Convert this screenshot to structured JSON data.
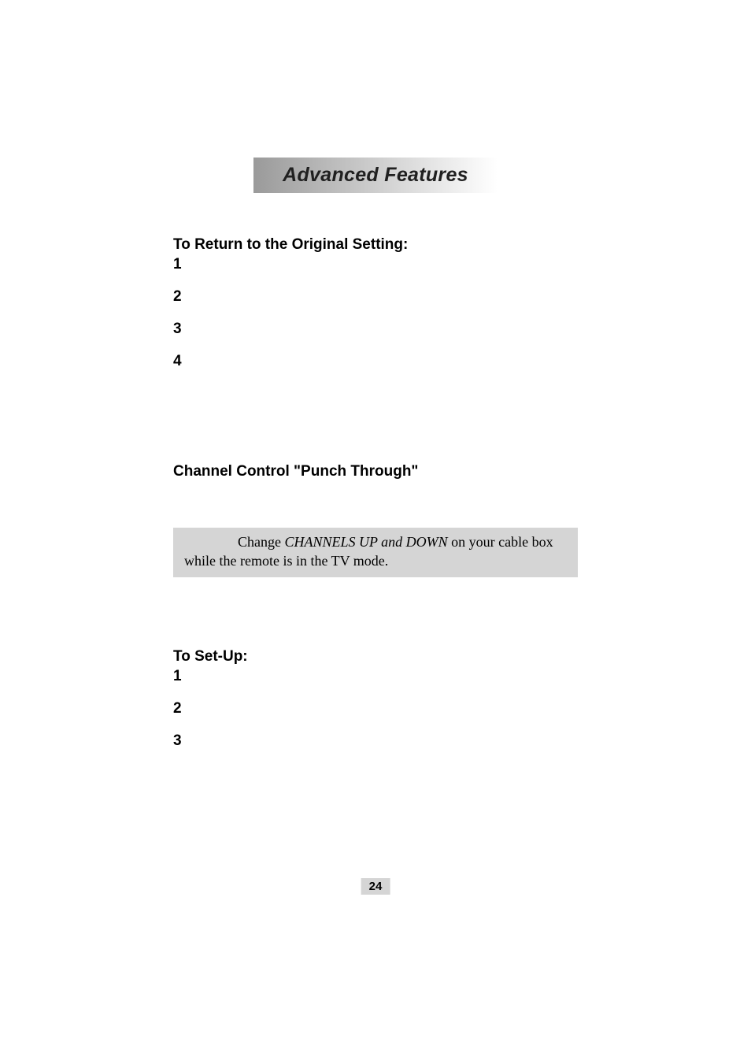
{
  "title": "Advanced Features",
  "sections": {
    "return_original": {
      "heading": "To Return to the Original Setting:",
      "steps": [
        "1",
        "2",
        "3",
        "4"
      ]
    },
    "punch_through": {
      "heading": "Channel Control \"Punch Through\"",
      "callout_lead": "Change ",
      "callout_italic": "CHANNELS UP and DOWN",
      "callout_tail": " on your cable box while the remote is in the TV mode."
    },
    "setup": {
      "heading": "To Set-Up:",
      "steps": [
        "1",
        "2",
        "3"
      ]
    }
  },
  "page_number": "24"
}
